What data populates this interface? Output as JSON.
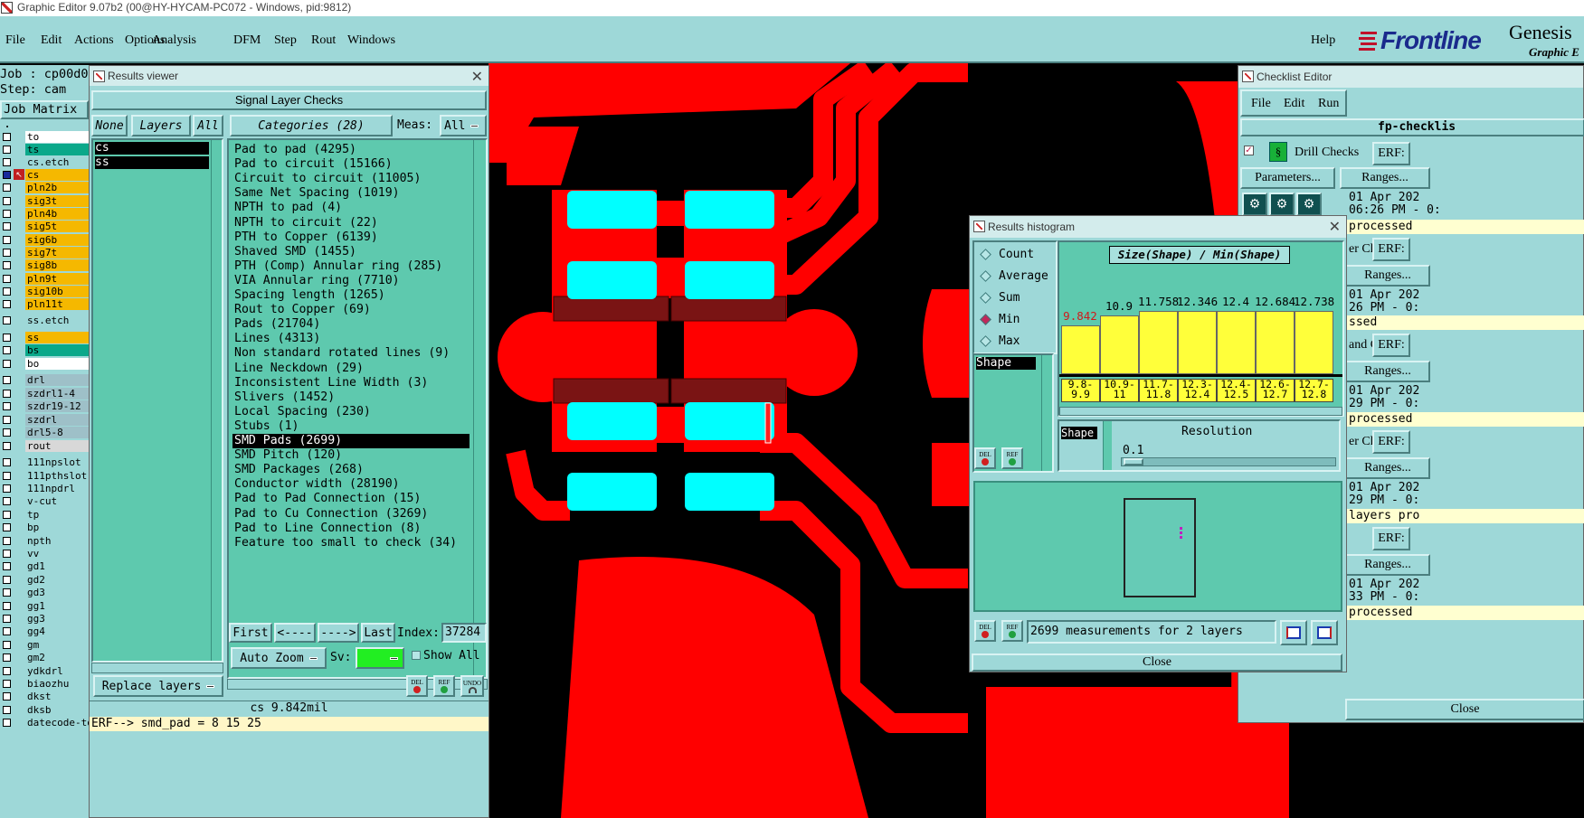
{
  "app": {
    "title": "Graphic Editor 9.07b2 (00@HY-HYCAM-PC072 - Windows, pid:9812)"
  },
  "menu": {
    "items": [
      "File",
      "Edit",
      "Actions",
      "Options",
      "Analysis",
      "DFM",
      "Step",
      "Rout",
      "Windows"
    ],
    "help": "Help"
  },
  "brand": {
    "logo": "Frontline",
    "product": "Genesis",
    "subtitle": "Graphic E"
  },
  "job": {
    "job": "Job : cp00d0",
    "step": "Step: cam",
    "matrix": "Job Matrix ."
  },
  "layers": [
    {
      "name": "to",
      "color": "#ffffff"
    },
    {
      "name": "ts",
      "color": "#0aa88a"
    },
    {
      "name": "cs.etch",
      "color": "#9ed8d8"
    },
    {
      "name": "cs",
      "color": "#f5b800"
    },
    {
      "name": "pln2b",
      "color": "#f5b800"
    },
    {
      "name": "sig3t",
      "color": "#f5b800"
    },
    {
      "name": "pln4b",
      "color": "#f5b800"
    },
    {
      "name": "sig5t",
      "color": "#f5b800"
    },
    {
      "name": "sig6b",
      "color": "#f5b800"
    },
    {
      "name": "sig7t",
      "color": "#f5b800"
    },
    {
      "name": "sig8b",
      "color": "#f5b800"
    },
    {
      "name": "pln9t",
      "color": "#f5b800"
    },
    {
      "name": "sig10b",
      "color": "#f5b800"
    },
    {
      "name": "pln11t",
      "color": "#f5b800"
    },
    {
      "name": "ss.etch",
      "color": "#9ed8d8"
    },
    {
      "name": "ss",
      "color": "#f5b800"
    },
    {
      "name": "bs",
      "color": "#0aa88a"
    },
    {
      "name": "bo",
      "color": "#ffffff"
    },
    {
      "name": "drl",
      "color": "#9ec0c8"
    },
    {
      "name": "szdrl1-4",
      "color": "#9ec0c8"
    },
    {
      "name": "szdr19-12",
      "color": "#9ec0c8"
    },
    {
      "name": "szdrl",
      "color": "#9ec0c8"
    },
    {
      "name": "drl5-8",
      "color": "#9ec0c8"
    },
    {
      "name": "rout",
      "color": "#d8d8d8"
    },
    {
      "name": "111npslot",
      "color": "#9ed8d8"
    },
    {
      "name": "111pthslot",
      "color": "#9ed8d8"
    },
    {
      "name": "111npdrl",
      "color": "#9ed8d8"
    },
    {
      "name": "v-cut",
      "color": "#9ed8d8"
    },
    {
      "name": "tp",
      "color": "#9ed8d8"
    },
    {
      "name": "bp",
      "color": "#9ed8d8"
    },
    {
      "name": "npth",
      "color": "#9ed8d8"
    },
    {
      "name": "vv",
      "color": "#9ed8d8"
    },
    {
      "name": "gd1",
      "color": "#9ed8d8"
    },
    {
      "name": "gd2",
      "color": "#9ed8d8"
    },
    {
      "name": "gd3",
      "color": "#9ed8d8"
    },
    {
      "name": "gg1",
      "color": "#9ed8d8"
    },
    {
      "name": "gg3",
      "color": "#9ed8d8"
    },
    {
      "name": "gg4",
      "color": "#9ed8d8"
    },
    {
      "name": "gm",
      "color": "#9ed8d8"
    },
    {
      "name": "gm2",
      "color": "#9ed8d8"
    },
    {
      "name": "ydkdrl",
      "color": "#9ed8d8"
    },
    {
      "name": "biaozhu",
      "color": "#9ed8d8"
    },
    {
      "name": "dkst",
      "color": "#9ed8d8"
    },
    {
      "name": "dksb",
      "color": "#9ed8d8"
    },
    {
      "name": "datecode-to",
      "color": "#9ed8d8"
    }
  ],
  "results_viewer": {
    "title": "Results viewer",
    "header": "Signal Layer Checks",
    "none_btn": "None",
    "layers_btn": "Layers",
    "all_btn": "All",
    "categories_btn": "Categories (28)",
    "meas_label": "Meas:",
    "meas_value": "All",
    "layer_list": [
      "cs",
      "ss"
    ],
    "categories": [
      "Pad to pad (4295)",
      "Pad to circuit (15166)",
      "Circuit to circuit (11005)",
      "Same Net Spacing (1019)",
      "NPTH to pad (4)",
      "NPTH to circuit (22)",
      "PTH to Copper (6139)",
      "Shaved SMD (1455)",
      "PTH (Comp) Annular ring (285)",
      "VIA Annular ring (7710)",
      "Spacing length (1265)",
      "Rout to Copper (69)",
      "Pads (21704)",
      "Lines (4313)",
      "Non standard rotated lines (9)",
      "Line Neckdown (29)",
      "Inconsistent Line Width (3)",
      "Slivers (1452)",
      "Local Spacing (230)",
      "Stubs (1)",
      "SMD Pads (2699)",
      "SMD Pitch (120)",
      "SMD Packages (268)",
      "Conductor width (28190)",
      "Pad to Pad Connection (15)",
      "Pad to Cu Connection (3269)",
      "Pad to Line Connection (8)",
      "Feature too small to check (34)"
    ],
    "selected_category": "SMD Pads (2699)",
    "nav": {
      "first": "First",
      "prev": "<----",
      "next": "---->",
      "last": "Last",
      "index_label": "Index:",
      "index_value": "37284"
    },
    "auto_zoom": "Auto Zoom",
    "sv_label": "Sv:",
    "show_all": "Show All",
    "replace_layers": "Replace layers",
    "icons": {
      "del": "DEL",
      "ref": "REF",
      "undo": "UNDO"
    },
    "status": "cs 9.842mil",
    "erf_line": "ERF--> smd_pad = 8 15 25"
  },
  "histogram": {
    "title": "Results histogram",
    "modes": [
      "Count",
      "Average",
      "Sum",
      "Min",
      "Max"
    ],
    "selected_mode": "Min",
    "list_item": "Shape",
    "chart_title": "Size(Shape) / Min(Shape)",
    "bar_values": [
      "9.842",
      "10.9",
      "11.758",
      "12.346",
      "12.4",
      "12.684",
      "12.738"
    ],
    "bar_fill": [
      0.6,
      0.72,
      0.78,
      0.78,
      0.78,
      0.78,
      0.78
    ],
    "ranges": [
      [
        "9.8-",
        "9.9"
      ],
      [
        "10.9-",
        "11"
      ],
      [
        "11.7-",
        "11.8"
      ],
      [
        "12.3-",
        "12.4"
      ],
      [
        "12.4-",
        "12.5"
      ],
      [
        "12.6-",
        "12.7"
      ],
      [
        "12.7-",
        "12.8"
      ]
    ],
    "shape_btn": "Shape",
    "resolution_label": "Resolution",
    "resolution_value": "0.1",
    "measurements": "2699 measurements for 2 layers",
    "close": "Close",
    "icons": {
      "del": "DEL",
      "ref": "REF"
    }
  },
  "checklist": {
    "title": "Checklist Editor",
    "menu": [
      "File",
      "Edit",
      "Run"
    ],
    "name": "fp-checklis",
    "drill_checks": "Drill Checks",
    "erf": "ERF:",
    "parameters": "Parameters...",
    "ranges": "Ranges...",
    "rows": [
      {
        "date": "01 Apr 202",
        "time": "06:26 PM - 0:",
        "status": "processed",
        "label": "l Che"
      },
      {
        "date": "01 Apr 202",
        "time": "26 PM - 0:",
        "status": "ssed",
        "label": "er Ch"
      },
      {
        "date": "01 Apr 202",
        "time": "29 PM - 0:",
        "status": "processed",
        "label": "and C"
      },
      {
        "date": "01 Apr 202",
        "time": "29 PM - 0:",
        "status": "layers pro",
        "label": "er Ch"
      },
      {
        "date": "01 Apr 202",
        "time": "33 PM - 0:",
        "status": "processed",
        "label": ""
      }
    ],
    "close": "Close"
  },
  "colors": {
    "teal": "#9ed8d8",
    "green": "#5ec9ae",
    "copper": "#ff0000",
    "pad": "#00ffff",
    "yellow": "#ffff3a"
  }
}
